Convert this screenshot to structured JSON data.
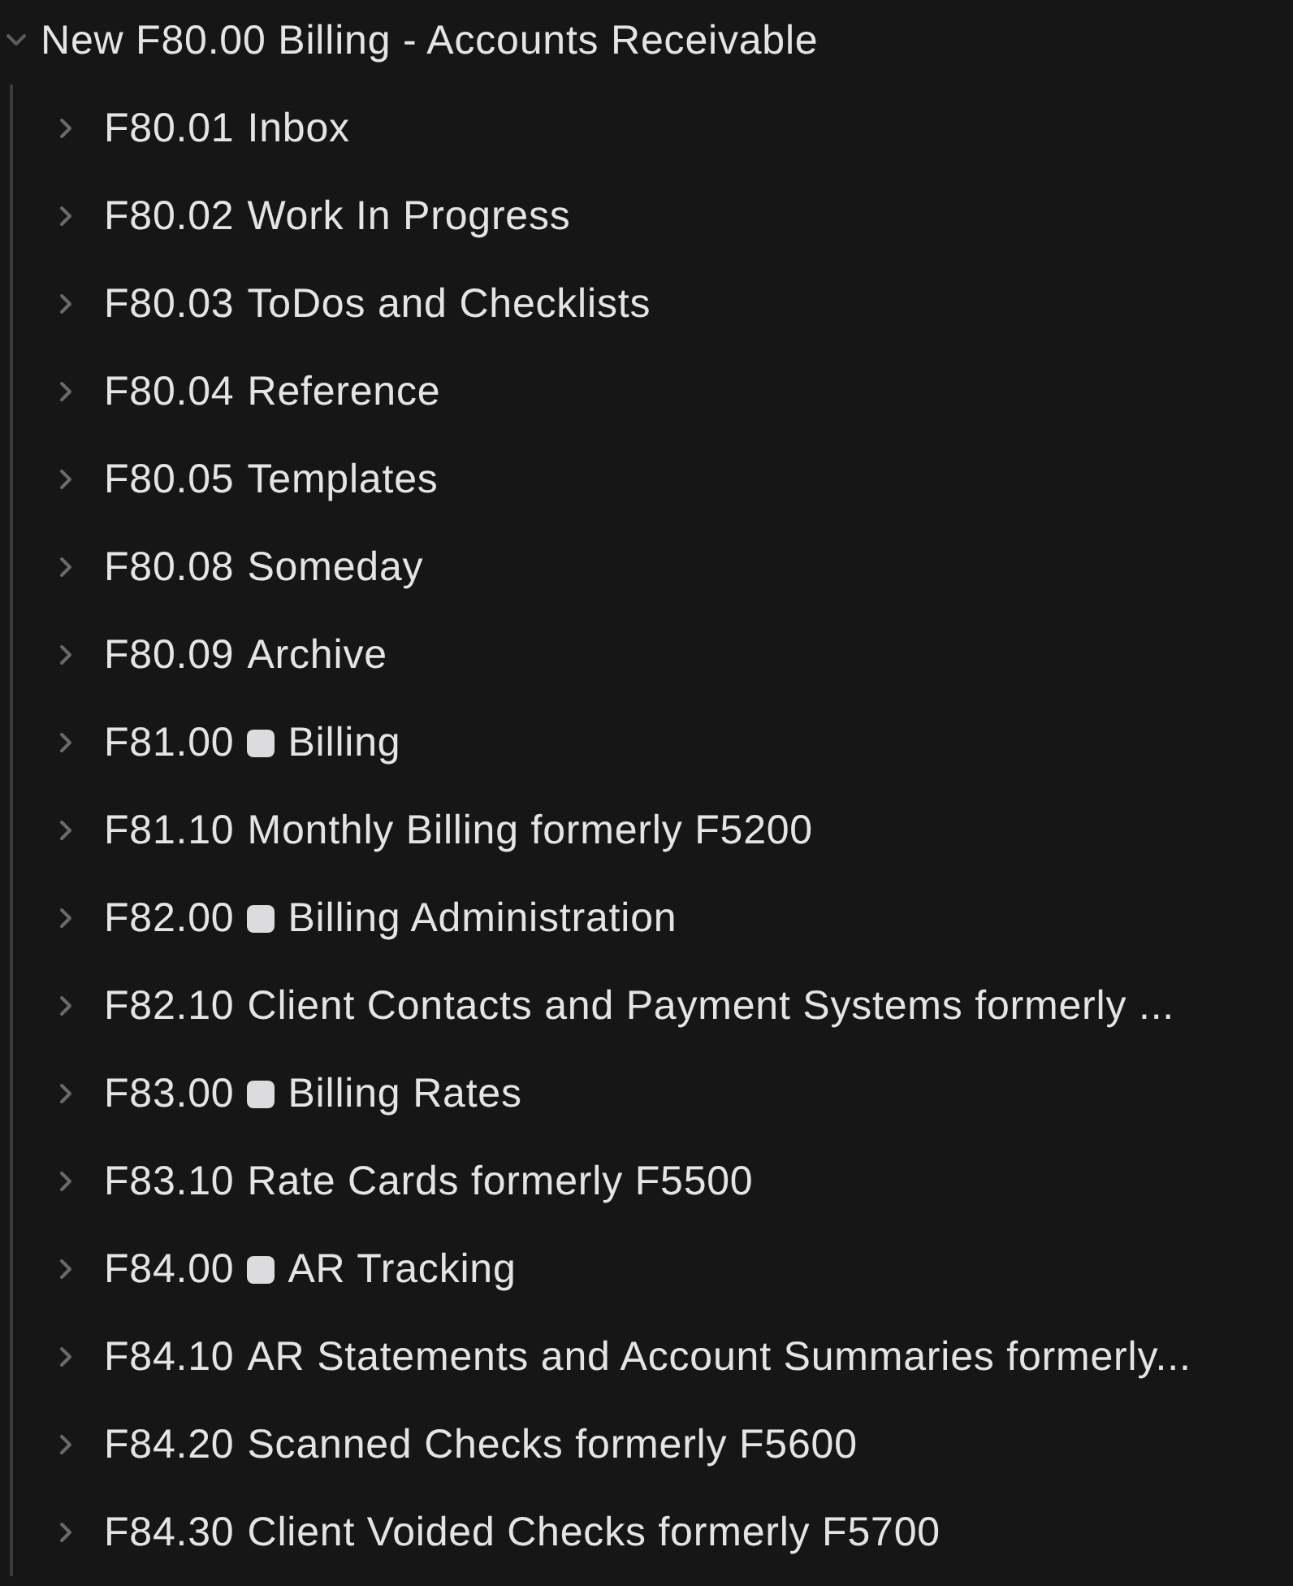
{
  "tree": {
    "label": "New F80.00 Billing - Accounts Receivable",
    "expanded": true,
    "children": [
      {
        "code": "F80.01",
        "label": "Inbox",
        "square": false,
        "expanded": false
      },
      {
        "code": "F80.02",
        "label": "Work In Progress",
        "square": false,
        "expanded": false
      },
      {
        "code": "F80.03",
        "label": "ToDos and Checklists",
        "square": false,
        "expanded": false
      },
      {
        "code": "F80.04",
        "label": "Reference",
        "square": false,
        "expanded": false
      },
      {
        "code": "F80.05",
        "label": "Templates",
        "square": false,
        "expanded": false
      },
      {
        "code": "F80.08",
        "label": "Someday",
        "square": false,
        "expanded": false
      },
      {
        "code": "F80.09",
        "label": "Archive",
        "square": false,
        "expanded": false
      },
      {
        "code": "F81.00",
        "label": "Billing",
        "square": true,
        "expanded": false
      },
      {
        "code": "F81.10",
        "label": "Monthly Billing formerly F5200",
        "square": false,
        "expanded": false
      },
      {
        "code": "F82.00",
        "label": "Billing Administration",
        "square": true,
        "expanded": false
      },
      {
        "code": "F82.10",
        "label": "Client Contacts and Payment Systems formerly ...",
        "square": false,
        "expanded": false
      },
      {
        "code": "F83.00",
        "label": "Billing Rates",
        "square": true,
        "expanded": false
      },
      {
        "code": "F83.10",
        "label": "Rate Cards formerly F5500",
        "square": false,
        "expanded": false
      },
      {
        "code": "F84.00",
        "label": "AR Tracking",
        "square": true,
        "expanded": false
      },
      {
        "code": "F84.10",
        "label": "AR Statements and Account Summaries formerly...",
        "square": false,
        "expanded": false
      },
      {
        "code": "F84.20",
        "label": "Scanned Checks formerly F5600",
        "square": false,
        "expanded": false
      },
      {
        "code": "F84.30",
        "label": "Client Voided Checks formerly F5700",
        "square": false,
        "expanded": false
      }
    ]
  }
}
